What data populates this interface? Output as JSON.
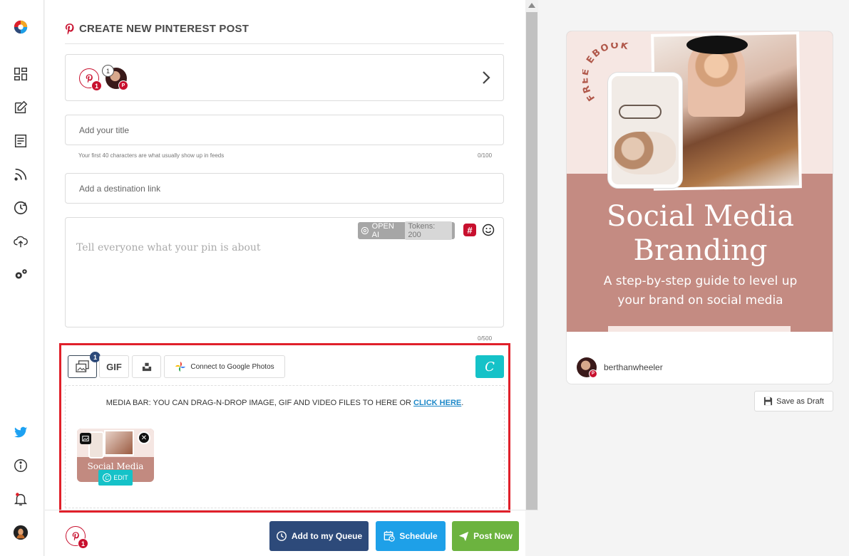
{
  "header": {
    "title": "CREATE NEW PINTEREST POST"
  },
  "accounts": {
    "pinterest_count": "1",
    "selected_count": "1"
  },
  "title_field": {
    "placeholder": "Add your title",
    "hint": "Your first 40 characters are what usually show up in feeds",
    "counter": "0/100"
  },
  "link_field": {
    "placeholder": "Add a destination link"
  },
  "description": {
    "placeholder": "Tell everyone what your pin is about",
    "openai_label": "OPEN AI",
    "tokens_label": "Tokens: 200",
    "counter": "0/500"
  },
  "media": {
    "image_count": "1",
    "gif_label": "GIF",
    "google_photos_label": "Connect to Google Photos",
    "drop_text": "MEDIA BAR: YOU CAN DRAG-N-DROP IMAGE, GIF AND VIDEO FILES TO HERE OR",
    "click_here": "CLICK HERE",
    "drop_text_end": ".",
    "thumb_title": "Social Media",
    "edit_label": "EDIT"
  },
  "footer": {
    "pinterest_count": "1",
    "queue_label": "Add to my Queue",
    "schedule_label": "Schedule",
    "post_label": "Post Now"
  },
  "preview": {
    "ebook_label": "FREE EBOOK",
    "headline_line1": "Social Media",
    "headline_line2": "Branding",
    "subtitle_line1": "A step-by-step guide to level up",
    "subtitle_line2": "your brand on social media",
    "username": "berthanwheeler",
    "save_draft_label": "Save as Draft"
  },
  "colors": {
    "pinterest_red": "#c8102e",
    "queue_button": "#2d4a7a",
    "schedule_button": "#1ea0e8",
    "post_button": "#6cb33f",
    "canva_teal": "#15c2c8",
    "highlight_frame": "#e0202a",
    "pin_rose": "#c48b82"
  }
}
